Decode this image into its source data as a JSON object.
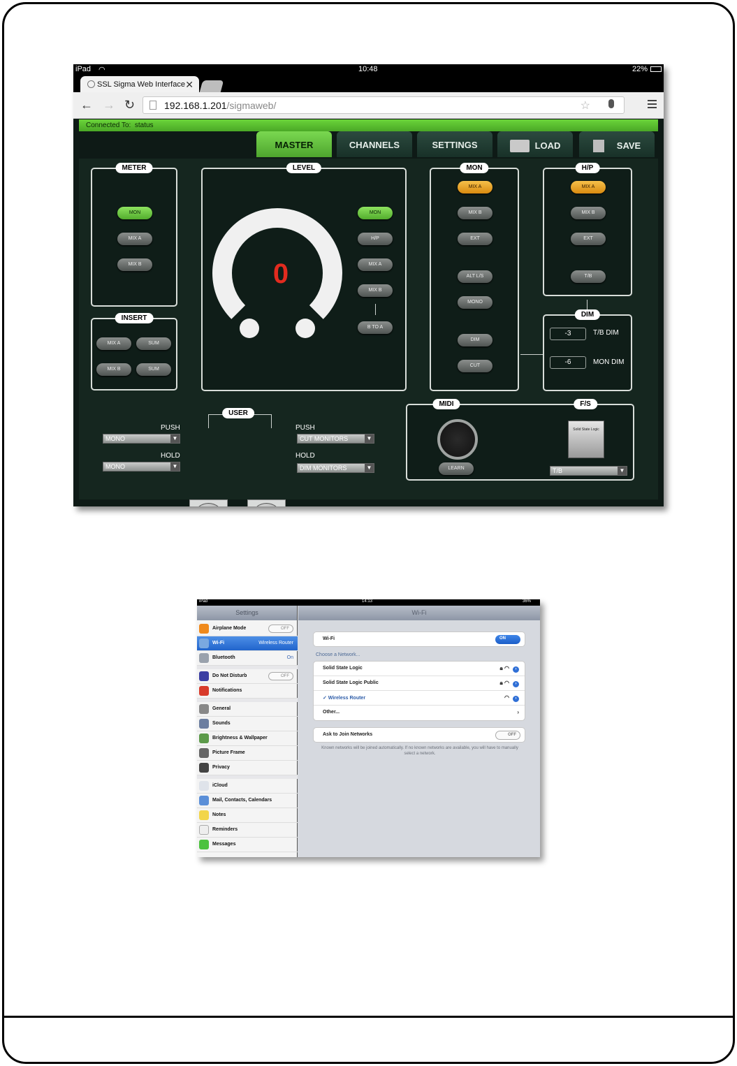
{
  "ipad": {
    "device": "iPad",
    "time": "10:48",
    "battery": "22%"
  },
  "browser": {
    "tab_title": "SSL Sigma Web Interface",
    "url_host": "192.168.1.201",
    "url_path": "/sigmaweb/"
  },
  "app": {
    "connected_label": "Connected To:",
    "connected_value": "status",
    "nav": {
      "master": "MASTER",
      "channels": "CHANNELS",
      "settings": "SETTINGS",
      "load": "LOAD",
      "save": "SAVE"
    },
    "meter": {
      "title": "METER",
      "mon": "MON",
      "mix_a": "MIX A",
      "mix_b": "MIX B"
    },
    "insert": {
      "title": "INSERT",
      "mix_a": "MIX A",
      "sum1": "SUM",
      "mix_b": "MIX B",
      "sum2": "SUM"
    },
    "level": {
      "title": "LEVEL",
      "value": "0",
      "mon": "MON",
      "hp": "H/P",
      "mix_a": "MIX A",
      "mix_b": "MIX B",
      "b_to_a": "B TO A"
    },
    "mon": {
      "title": "MON",
      "mix_a": "MIX A",
      "mix_b": "MIX B",
      "ext": "EXT",
      "alt": "ALT L/S",
      "mono": "MONO",
      "dim": "DIM",
      "cut": "CUT"
    },
    "hp": {
      "title": "H/P",
      "mix_a": "MIX A",
      "mix_b": "MIX B",
      "ext": "EXT",
      "tb": "T/B"
    },
    "dim": {
      "title": "DIM",
      "tb_value": "-3",
      "tb_label": "T/B DIM",
      "mon_value": "-6",
      "mon_label": "MON DIM"
    },
    "user": {
      "title": "USER",
      "push_label_left": "PUSH",
      "push_left": "MONO",
      "hold_label_left": "HOLD",
      "hold_left": "MONO",
      "push_label_right": "PUSH",
      "push_right": "CUT MONITORS",
      "hold_label_right": "HOLD",
      "hold_right": "DIM MONITORS"
    },
    "midi": {
      "title": "MIDI",
      "learn": "LEARN"
    },
    "fs": {
      "title": "F/S",
      "pedal_label": "Solid State Logic",
      "select": "T/B"
    }
  },
  "settings": {
    "status_device": "iPad",
    "status_time": "14:13",
    "status_battery": "36%",
    "sidebar_title": "Settings",
    "main_title": "Wi-Fi",
    "items": [
      {
        "label": "Airplane Mode",
        "value": "OFF"
      },
      {
        "label": "Wi-Fi",
        "value": "Wireless Router"
      },
      {
        "label": "Bluetooth",
        "value": "On"
      },
      {
        "label": "Do Not Disturb",
        "value": "OFF"
      },
      {
        "label": "Notifications"
      },
      {
        "label": "General"
      },
      {
        "label": "Sounds"
      },
      {
        "label": "Brightness & Wallpaper"
      },
      {
        "label": "Picture Frame"
      },
      {
        "label": "Privacy"
      },
      {
        "label": "iCloud"
      },
      {
        "label": "Mail, Contacts, Calendars"
      },
      {
        "label": "Notes"
      },
      {
        "label": "Reminders"
      },
      {
        "label": "Messages"
      }
    ],
    "wifi_label": "Wi-Fi",
    "wifi_toggle": "ON",
    "choose_network": "Choose a Network...",
    "networks": [
      {
        "name": "Solid State Logic"
      },
      {
        "name": "Solid State Logic Public"
      },
      {
        "name": "✓ Wireless Router"
      },
      {
        "name": "Other..."
      }
    ],
    "ask_join": "Ask to Join Networks",
    "ask_join_toggle": "OFF",
    "note": "Known networks will be joined automatically. If no known networks are available, you will have to manually select a network."
  }
}
